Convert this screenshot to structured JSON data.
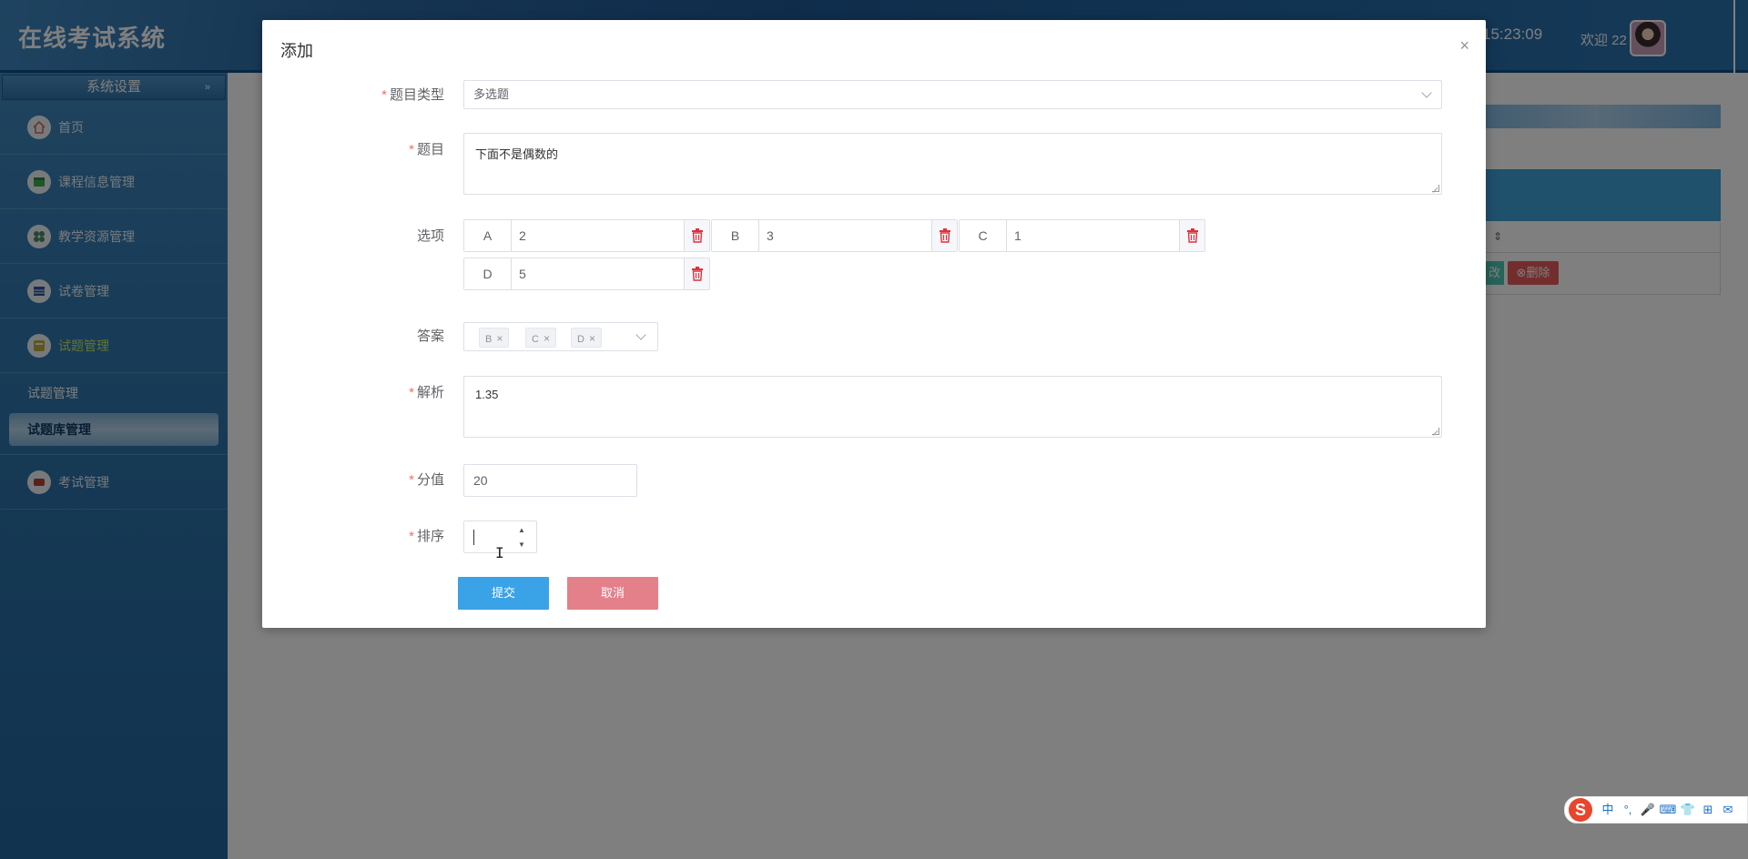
{
  "header": {
    "app_title": "在线考试系统",
    "clock": "15:23:09",
    "welcome": "欢迎 22"
  },
  "sidebar": {
    "section_title": "系统设置",
    "items": [
      {
        "label": "首页",
        "icon": "home-icon"
      },
      {
        "label": "课程信息管理",
        "icon": "course-icon"
      },
      {
        "label": "教学资源管理",
        "icon": "resource-icon"
      },
      {
        "label": "试卷管理",
        "icon": "paper-icon"
      },
      {
        "label": "试题管理",
        "icon": "question-icon"
      },
      {
        "label": "考试管理",
        "icon": "exam-icon"
      }
    ],
    "subitems": [
      {
        "label": "试题管理"
      },
      {
        "label": "试题库管理"
      }
    ]
  },
  "background": {
    "edit_label": "改",
    "delete_label": "删除"
  },
  "dialog": {
    "title": "添加",
    "close": "×",
    "fields": {
      "type_label": "题目类型",
      "type_value": "多选题",
      "question_label": "题目",
      "question_value": "下面不是偶数的",
      "options_label": "选项",
      "options": [
        {
          "letter": "A",
          "value": "2"
        },
        {
          "letter": "B",
          "value": "3"
        },
        {
          "letter": "C",
          "value": "1"
        },
        {
          "letter": "D",
          "value": "5"
        }
      ],
      "answer_label": "答案",
      "answer_tags": [
        "B",
        "C",
        "D"
      ],
      "analysis_label": "解析",
      "analysis_value": "1.35",
      "score_label": "分值",
      "score_value": "20",
      "sort_label": "排序",
      "sort_value": ""
    },
    "buttons": {
      "submit": "提交",
      "cancel": "取消"
    }
  },
  "ime": {
    "logo": "S",
    "items": [
      "中",
      "°,",
      "🎤",
      "⌨",
      "👕",
      "⊞",
      "✉"
    ]
  },
  "colors": {
    "primary": "#3aa2e6",
    "danger": "#e38089",
    "required": "#f56c6c",
    "active_menu": "#d4f25a"
  }
}
